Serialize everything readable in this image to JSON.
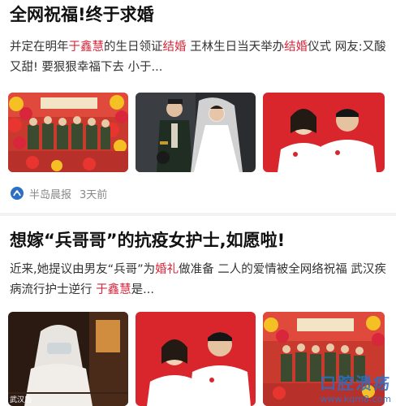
{
  "articles": [
    {
      "title": "全网祝福!终于求婚",
      "summary": {
        "p1": "并定在明年",
        "p2": "于鑫慧",
        "p3": "的生日领证",
        "p4": "结婚",
        "p5": " 王林生日当天举办",
        "p6": "结婚",
        "p7": "仪式 网友:又酸又甜! 要狠狠幸福下去 小于..."
      },
      "images": [
        "group-photo-red-balloons",
        "wedding-photo-uniform-dress",
        "couple-photo-red-background"
      ],
      "source": "半岛晨报",
      "time": "3天前"
    },
    {
      "title": "想嫁“兵哥哥”的抗疫女护士,如愿啦!",
      "summary": {
        "p1": "近来,她提议由男友“兵哥”为",
        "p2": "婚礼",
        "p3": "做准备 二人的爱情被全网络祝福 武汉疾病流行护士逆行 ",
        "p4": "于鑫慧",
        "p5": "是..."
      },
      "images": [
        "nurse-protective-suit",
        "couple-photo-red-background",
        "group-photo-red-balloons"
      ],
      "image_caption": "武汉后"
    }
  ],
  "watermark": {
    "text": "口腔溃疡",
    "url": "www.kqm8.com"
  },
  "colors": {
    "highlight": "#d8263a",
    "title": "#111111",
    "meta": "#888888",
    "source_icon": "#2d6fc4"
  }
}
